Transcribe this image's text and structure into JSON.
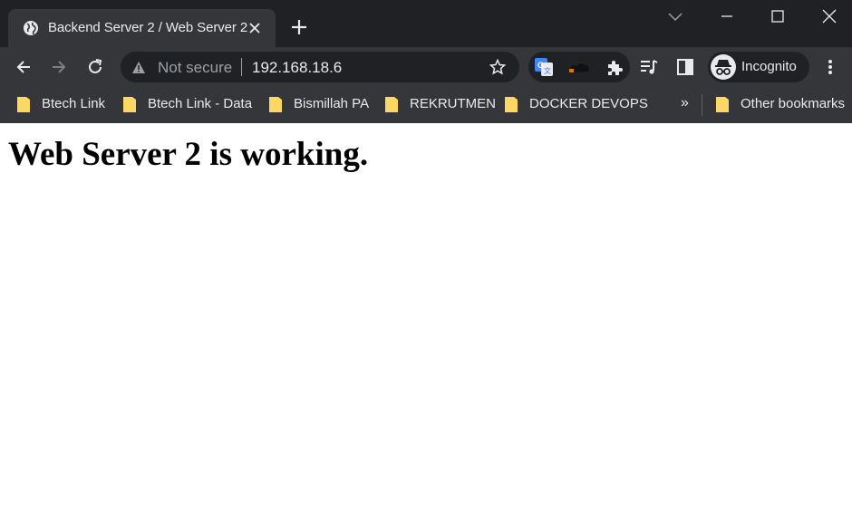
{
  "browser": {
    "tab": {
      "title": "Backend Server 2 / Web Server 2",
      "favicon": "globe-icon"
    },
    "omnibox": {
      "security_label": "Not secure",
      "url": "192.168.18.6"
    },
    "profile": {
      "label": "Incognito"
    },
    "bookmarks": [
      {
        "label": "Btech Link"
      },
      {
        "label": "Btech Link - Data"
      },
      {
        "label": "Bismillah PA"
      },
      {
        "label": "REKRUTMEN"
      },
      {
        "label": "DOCKER DEVOPS"
      }
    ],
    "bookmarks_overflow": "»",
    "other_bookmarks": "Other bookmarks",
    "colors": {
      "frame": "#202124",
      "toolbar": "#35363a",
      "text": "#e8eaed",
      "muted": "#9aa0a6",
      "folder": "#fdd663"
    }
  },
  "page": {
    "heading": "Web Server 2 is working."
  }
}
